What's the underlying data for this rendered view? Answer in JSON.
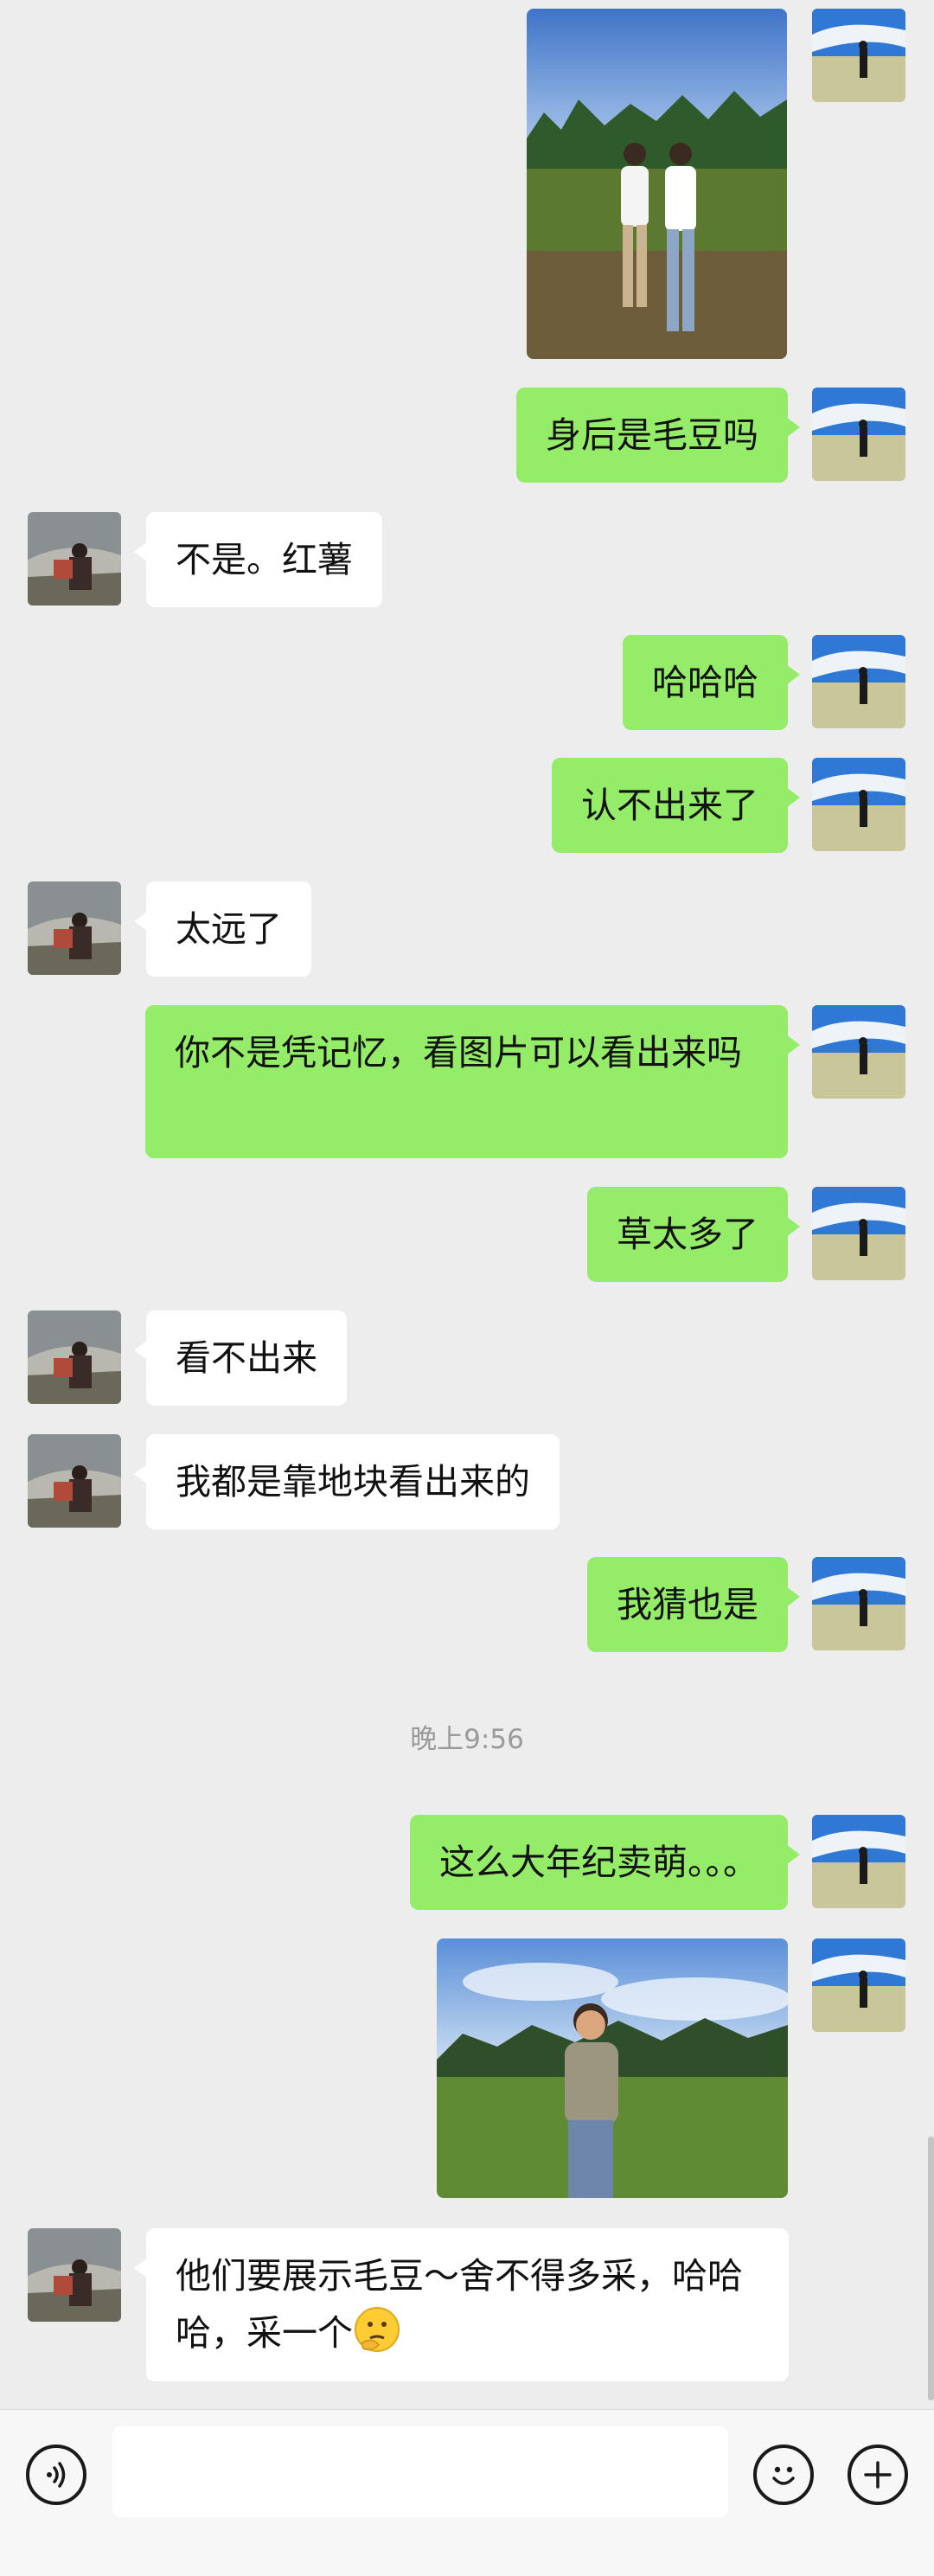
{
  "messages": [
    {
      "from": "me",
      "type": "image",
      "description": ""
    },
    {
      "from": "me",
      "type": "text",
      "text": "身后是毛豆吗"
    },
    {
      "from": "them",
      "type": "text",
      "text": "不是。红薯"
    },
    {
      "from": "me",
      "type": "text",
      "text": "哈哈哈"
    },
    {
      "from": "me",
      "type": "text",
      "text": "认不出来了"
    },
    {
      "from": "them",
      "type": "text",
      "text": "太远了"
    },
    {
      "from": "me",
      "type": "text",
      "text": "你不是凭记忆，看图片可以看出来吗"
    },
    {
      "from": "me",
      "type": "text",
      "text": "草太多了"
    },
    {
      "from": "them",
      "type": "text",
      "text": "看不出来"
    },
    {
      "from": "them",
      "type": "text",
      "text": "我都是靠地块看出来的"
    },
    {
      "from": "me",
      "type": "text",
      "text": "我猜也是"
    },
    {
      "type": "timestamp",
      "text": "晚上9:56"
    },
    {
      "from": "me",
      "type": "text",
      "text": "这么大年纪卖萌。。。"
    },
    {
      "from": "me",
      "type": "image"
    },
    {
      "from": "them",
      "type": "text",
      "text": "他们要展示毛豆～舍不得多采，哈哈哈，采一个",
      "emoji": "thinking-face"
    }
  ],
  "colors": {
    "background": "#ededed",
    "my_bubble": "#95ec69",
    "their_bubble": "#ffffff",
    "timestamp": "#9a9a9a"
  },
  "bottom_bar": {
    "icons": [
      "voice-icon",
      "emoji-icon",
      "plus-icon"
    ],
    "input_value": ""
  }
}
